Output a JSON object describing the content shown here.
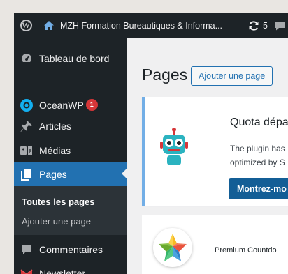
{
  "adminbar": {
    "site_name": "MZH Formation Bureautiques & Informa...",
    "updates_count": "5"
  },
  "sidebar": {
    "items": [
      {
        "label": "Tableau de bord",
        "icon": "dashboard-icon"
      },
      {
        "label": "OceanWP",
        "icon": "oceanwp-icon",
        "badge": "1"
      },
      {
        "label": "Articles",
        "icon": "pin-icon"
      },
      {
        "label": "Médias",
        "icon": "media-icon"
      },
      {
        "label": "Pages",
        "icon": "page-icon",
        "active": true
      },
      {
        "label": "Commentaires",
        "icon": "comment-icon"
      },
      {
        "label": "Newsletter",
        "icon": "mail-icon"
      }
    ],
    "submenu": [
      {
        "label": "Toutes les pages",
        "current": true
      },
      {
        "label": "Ajouter une page"
      }
    ]
  },
  "main": {
    "title": "Pages",
    "add_button": "Ajouter une page",
    "notice": {
      "title": "Quota dépa",
      "line1": "The plugin has",
      "line2": "optimized by S",
      "button": "Montrez-mo"
    },
    "card2_title": "Premium Countdo"
  },
  "colors": {
    "adminbar_bg": "#1d2327",
    "active_bg": "#2271b1",
    "badge": "#d63638",
    "notice_border": "#72aee6",
    "primary_button": "#135e96"
  }
}
